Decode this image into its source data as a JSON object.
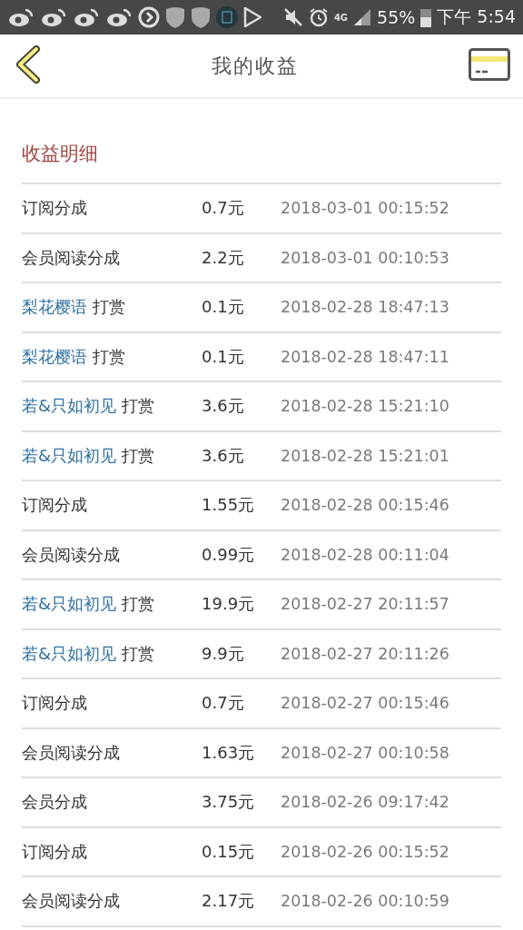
{
  "status_bar": {
    "battery_text": "55%",
    "time": "下午 5:54",
    "network": "4G"
  },
  "header": {
    "title": "我的收益"
  },
  "section": {
    "title": "收益明细"
  },
  "rows": [
    {
      "kind": "plain",
      "label": "订阅分成",
      "amount": "0.7元",
      "date": "2018-03-01 00:15:52"
    },
    {
      "kind": "plain",
      "label": "会员阅读分成",
      "amount": "2.2元",
      "date": "2018-03-01 00:10:53"
    },
    {
      "kind": "tip",
      "user": "梨花樱语",
      "label": "打赏",
      "amount": "0.1元",
      "date": "2018-02-28 18:47:13"
    },
    {
      "kind": "tip",
      "user": "梨花樱语",
      "label": "打赏",
      "amount": "0.1元",
      "date": "2018-02-28 18:47:11"
    },
    {
      "kind": "tip",
      "user": "若&只如初见",
      "label": "打赏",
      "amount": "3.6元",
      "date": "2018-02-28 15:21:10"
    },
    {
      "kind": "tip",
      "user": "若&只如初见",
      "label": "打赏",
      "amount": "3.6元",
      "date": "2018-02-28 15:21:01"
    },
    {
      "kind": "plain",
      "label": "订阅分成",
      "amount": "1.55元",
      "date": "2018-02-28 00:15:46"
    },
    {
      "kind": "plain",
      "label": "会员阅读分成",
      "amount": "0.99元",
      "date": "2018-02-28 00:11:04"
    },
    {
      "kind": "tip",
      "user": "若&只如初见",
      "label": "打赏",
      "amount": "19.9元",
      "date": "2018-02-27 20:11:57"
    },
    {
      "kind": "tip",
      "user": "若&只如初见",
      "label": "打赏",
      "amount": "9.9元",
      "date": "2018-02-27 20:11:26"
    },
    {
      "kind": "plain",
      "label": "订阅分成",
      "amount": "0.7元",
      "date": "2018-02-27 00:15:46"
    },
    {
      "kind": "plain",
      "label": "会员阅读分成",
      "amount": "1.63元",
      "date": "2018-02-27 00:10:58"
    },
    {
      "kind": "plain",
      "label": "会员分成",
      "amount": "3.75元",
      "date": "2018-02-26 09:17:42"
    },
    {
      "kind": "plain",
      "label": "订阅分成",
      "amount": "0.15元",
      "date": "2018-02-26 00:15:52"
    },
    {
      "kind": "plain",
      "label": "会员阅读分成",
      "amount": "2.17元",
      "date": "2018-02-26 00:10:59"
    }
  ]
}
